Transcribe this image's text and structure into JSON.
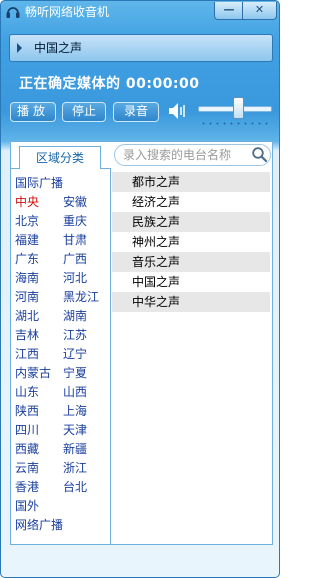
{
  "window": {
    "title": "畅听网络收音机",
    "min_label": "—",
    "close_label": "✕"
  },
  "current_station": "中国之声",
  "status": "正在确定媒体的 00:00:00",
  "controls": {
    "play": "播放",
    "stop": "停止",
    "record": "录音"
  },
  "volume": 0.55,
  "panel": {
    "tab_label": "区域分类",
    "search_placeholder": "录入搜索的电台名称"
  },
  "regions": [
    [
      "国际广播"
    ],
    [
      "中央",
      "安徽"
    ],
    [
      "北京",
      "重庆"
    ],
    [
      "福建",
      "甘肃"
    ],
    [
      "广东",
      "广西"
    ],
    [
      "海南",
      "河北"
    ],
    [
      "河南",
      "黑龙江"
    ],
    [
      "湖北",
      "湖南"
    ],
    [
      "吉林",
      "江苏"
    ],
    [
      "江西",
      "辽宁"
    ],
    [
      "内蒙古",
      "宁夏"
    ],
    [
      "山东",
      "山西"
    ],
    [
      "陕西",
      "上海"
    ],
    [
      "四川",
      "天津"
    ],
    [
      "西藏",
      "新疆"
    ],
    [
      "云南",
      "浙江"
    ],
    [
      "香港",
      "台北"
    ],
    [
      "国外"
    ],
    [
      "网络广播"
    ]
  ],
  "active_region": "中央",
  "stations": [
    "都市之声",
    "经济之声",
    "民族之声",
    "神州之声",
    "音乐之声",
    "中国之声",
    "中华之声"
  ],
  "colors": {
    "accent": "#3a98dc",
    "link": "#1a3f9e",
    "active": "#d01010"
  }
}
